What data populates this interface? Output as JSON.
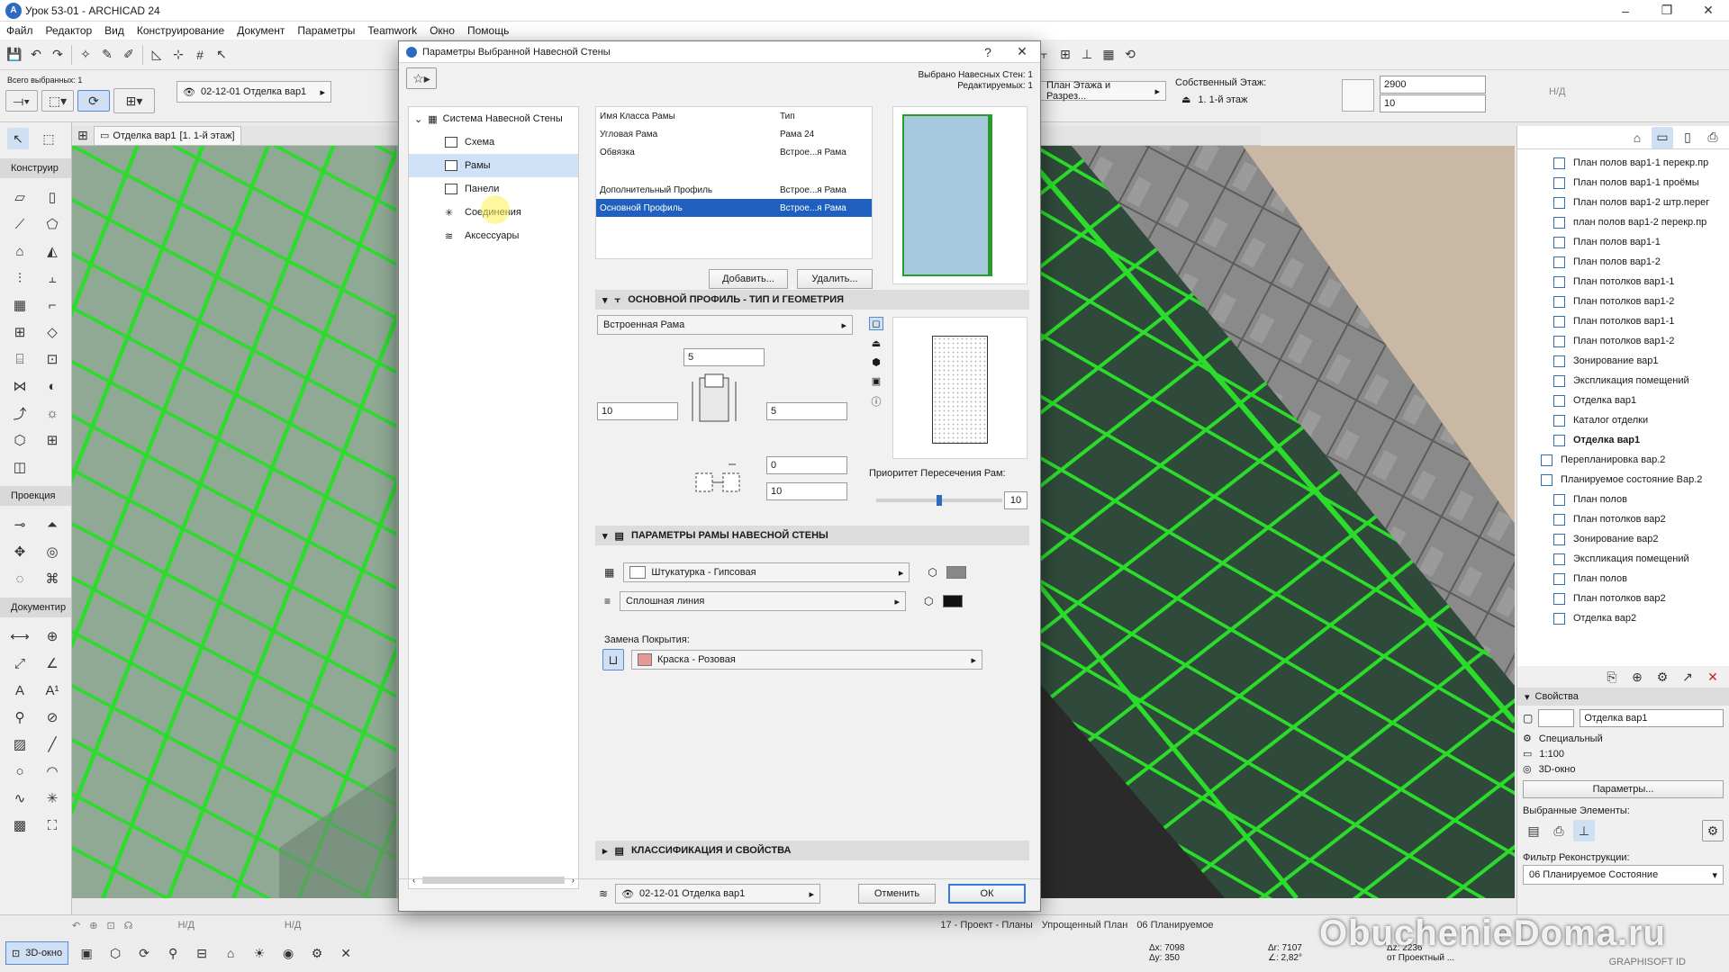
{
  "window": {
    "title": "Урок 53-01 - ARCHICAD 24",
    "controls": [
      "–",
      "❐",
      "✕"
    ]
  },
  "menu": [
    "Файл",
    "Редактор",
    "Вид",
    "Конструирование",
    "Документ",
    "Параметры",
    "Teamwork",
    "Окно",
    "Помощь"
  ],
  "infobox": {
    "selected_label": "Всего выбранных: 1",
    "layer_value": "02-12-01 Отделка вар1",
    "home_story_label": "Собственный Этаж:",
    "home_story_value": "1. 1-й этаж",
    "height_value": "2900",
    "offset_value": "10",
    "angle_value": "Н/Д",
    "views_combo": "План Этажа и Разрез..."
  },
  "toolbox": {
    "sections": [
      "Конструир",
      "Проекция",
      "Документир"
    ]
  },
  "view_tab": {
    "label": "[1. 1-й этаж]",
    "prefix": "Отделка вар1"
  },
  "dialog": {
    "title": "Параметры Выбранной Навесной Стены",
    "help": "?",
    "close": "✕",
    "selected_info": "Выбрано Навесных Стен: 1",
    "editable_info": "Редактируемых: 1",
    "tree": {
      "root": "Система Навесной Стены",
      "items": [
        "Схема",
        "Рамы",
        "Панели",
        "Соединения",
        "Аксессуары"
      ],
      "active_index": 1
    },
    "frame_table": {
      "header": [
        "Имя Класса Рамы",
        "Тип"
      ],
      "rows": [
        [
          "Угловая Рама",
          "Рама 24"
        ],
        [
          "Обвязка",
          "Встрое...я Рама"
        ],
        [
          "Дополнительный Профиль",
          "Встрое...я Рама"
        ],
        [
          "Основной Профиль",
          "Встрое...я Рама"
        ]
      ],
      "selected_row": 3
    },
    "add_button": "Добавить...",
    "delete_button": "Удалить...",
    "section_geometry": "ОСНОВНОЙ ПРОФИЛЬ - ТИП И ГЕОМЕТРИЯ",
    "frame_type": "Встроенная Рама",
    "dims": {
      "top": "5",
      "left": "10",
      "right": "5",
      "offset1": "0",
      "offset2": "10"
    },
    "priority_label": "Приоритет Пересечения Рам:",
    "priority_value": "10",
    "priority_level": 0.5,
    "section_params": "ПАРАМЕТРЫ РАМЫ НАВЕСНОЙ СТЕНЫ",
    "material": "Штукатурка - Гипсовая",
    "line_type": "Сплошная линия",
    "surface_override_label": "Замена Покрытия:",
    "surface": "Краска - Розовая",
    "section_class": "КЛАССИФИКАЦИЯ И СВОЙСТВА",
    "layer": "02-12-01 Отделка вар1",
    "cancel_button": "Отменить",
    "ok_button": "ОК",
    "colors": {
      "selected_row": "#1f5fbf",
      "ok_border": "#3b78d8",
      "surface_swatch": "#e39a94",
      "preview_fill": "#a7c8de",
      "frame_green": "#2bdc2b"
    }
  },
  "navigator": {
    "items": [
      {
        "label": "План полов вар1-1 перекр.пр",
        "bold": false
      },
      {
        "label": "План полов вар1-1 проёмы",
        "bold": false
      },
      {
        "label": "План полов вар1-2 штр.перег",
        "bold": false
      },
      {
        "label": "план полов вар1-2 перекр.пр",
        "bold": false
      },
      {
        "label": "План полов вар1-1",
        "bold": false
      },
      {
        "label": "План полов вар1-2",
        "bold": false
      },
      {
        "label": "План потолков вар1-1",
        "bold": false
      },
      {
        "label": "План потолков вар1-2",
        "bold": false
      },
      {
        "label": "План потолков вар1-1",
        "bold": false
      },
      {
        "label": "План потолков вар1-2",
        "bold": false
      },
      {
        "label": "Зонирование вар1",
        "bold": false
      },
      {
        "label": "Экспликация помещений",
        "bold": false
      },
      {
        "label": "Отделка вар1",
        "bold": false
      },
      {
        "label": "Каталог отделки",
        "bold": false
      },
      {
        "label": "Отделка вар1",
        "bold": true
      },
      {
        "label": "Перепланировка вар.2",
        "bold": false
      },
      {
        "label": "Планируемое состояние Вар.2",
        "bold": false
      },
      {
        "label": "План полов",
        "bold": false
      },
      {
        "label": "План потолков вар2",
        "bold": false
      },
      {
        "label": "Зонирование вар2",
        "bold": false
      },
      {
        "label": "Экспликация помещений",
        "bold": false
      },
      {
        "label": "План полов",
        "bold": false
      },
      {
        "label": "План потолков вар2",
        "bold": false
      },
      {
        "label": "Отделка вар2",
        "bold": false
      }
    ]
  },
  "properties": {
    "header": "Свойства",
    "name_value": "Отделка вар1",
    "type": "Специальный",
    "scale": "1:100",
    "window": "3D-окно",
    "params_button": "Параметры...",
    "selected_elements_label": "Выбранные Элементы:",
    "renovation_label": "Фильтр Реконструкции:",
    "renovation_value": "06 Планируемое Состояние"
  },
  "statusbar": {
    "mode": "3D-окно",
    "nd1": "Н/Д",
    "nd2": "Н/Д",
    "tabs": [
      "17 - Проект - Планы",
      "Упрощенный План",
      "06 Планируемое"
    ],
    "dx": "Δx: 7098",
    "dy": "Δy: 350",
    "dr": "Δr: 7107",
    "da": "∠: 2,82°",
    "dz": "Δz: 2236",
    "from": "от Проектный ...",
    "brand": "GRAPHISOFT ID",
    "watermark": "ObuchenieDoma.ru"
  }
}
